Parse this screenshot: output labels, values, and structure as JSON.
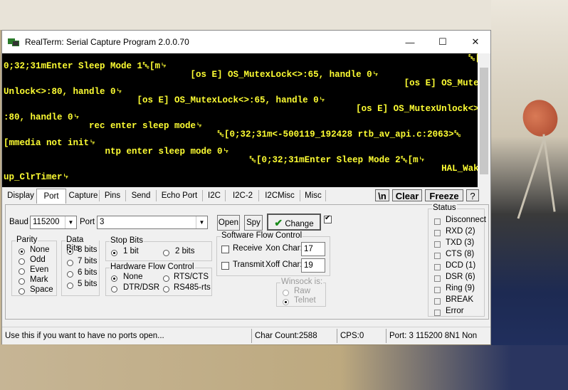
{
  "window": {
    "title": "RealTerm: Serial Capture Program 2.0.0.70",
    "minimize": "—",
    "maximize": "☐",
    "close": "✕"
  },
  "terminal": {
    "lines": [
      "                                                                                       ␛[",
      "0;32;31mEnter Sleep Mode 1␛[m␊",
      "                                   [os E] OS_MutexLock<>:65, handle 0␊",
      "                                                                           [os E] OS_Mutex",
      "Unlock<>:80, handle 0␊",
      "                         [os E] OS_MutexLock<>:65, handle 0␊",
      "                                                                  [os E] OS_MutexUnlock<>",
      ":80, handle 0␊",
      "                rec enter sleep mode␊",
      "                                        ␛[0;32;31m<-500119_192428 rtb_av_api.c:2063>␛",
      "[mmedia not init␊",
      "                   ntp enter sleep mode 0␊",
      "                                              ␛[0;32;31mEnter Sleep Mode 2␛[m␊",
      "                                                                                  HAL_Wake",
      "up_ClrTimer␊"
    ]
  },
  "tabs": [
    "Display",
    "Port",
    "Capture",
    "Pins",
    "Send",
    "Echo Port",
    "I2C",
    "I2C-2",
    "I2CMisc",
    "Misc"
  ],
  "toolbar": {
    "newline": "\\n",
    "clear": "Clear",
    "freeze": "Freeze",
    "help": "?"
  },
  "port": {
    "baud_label": "Baud",
    "baud_value": "115200",
    "port_label": "Port",
    "port_value": "3",
    "open_label": "Open",
    "spy_label": "Spy",
    "change_label": "Change"
  },
  "parity": {
    "title": "Parity",
    "options": [
      "None",
      "Odd",
      "Even",
      "Mark",
      "Space"
    ],
    "selected": "None"
  },
  "databits": {
    "title": "Data Bits",
    "options": [
      "8 bits",
      "7 bits",
      "6 bits",
      "5 bits"
    ],
    "selected": "8 bits"
  },
  "stopbits": {
    "title": "Stop Bits",
    "options": [
      "1 bit",
      "2 bits"
    ],
    "selected": "1 bit"
  },
  "hwflow": {
    "title": "Hardware Flow Control",
    "options": [
      "None",
      "RTS/CTS",
      "DTR/DSR",
      "RS485-rts"
    ],
    "selected": "None"
  },
  "swflow": {
    "title": "Software Flow Control",
    "receive": "Receive",
    "transmit": "Transmit",
    "xon_label": "Xon Char:",
    "xon_value": "17",
    "xoff_label": "Xoff Char:",
    "xoff_value": "19"
  },
  "winsock": {
    "title": "Winsock is:",
    "options": [
      "Raw",
      "Telnet"
    ],
    "selected": "Telnet"
  },
  "status": {
    "title": "Status",
    "items": [
      "Disconnect",
      "RXD (2)",
      "TXD (3)",
      "CTS (8)",
      "DCD (1)",
      "DSR (6)",
      "Ring (9)",
      "BREAK",
      "Error"
    ]
  },
  "statusbar": {
    "hint": "Use this if you want to have no ports open...",
    "char_count": "Char Count:2588",
    "cps": "CPS:0",
    "port_info": "Port: 3 115200 8N1 Non"
  },
  "colors": {
    "terminal_bg": "#000000",
    "terminal_fg": "#ffff33"
  }
}
